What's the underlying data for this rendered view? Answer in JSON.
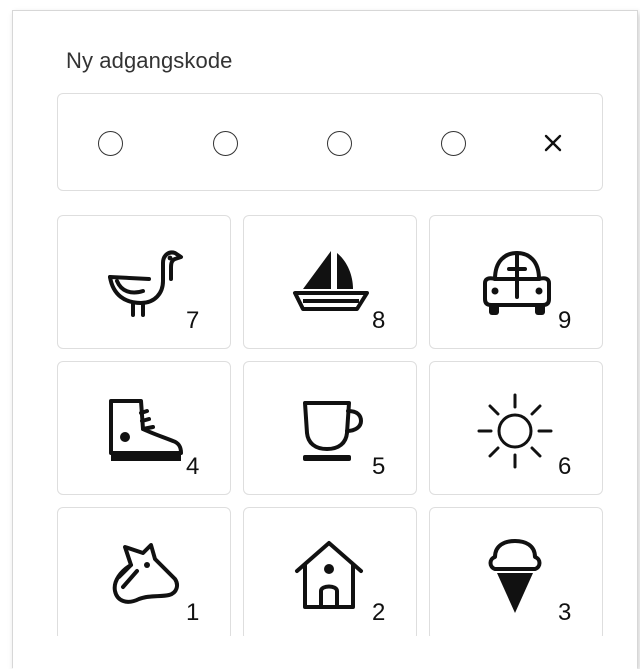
{
  "title": "Ny adgangskode",
  "code": {
    "slots": 4,
    "clear_label": "×"
  },
  "keypad": [
    {
      "icon": "bird-icon",
      "digit": "7"
    },
    {
      "icon": "sailboat-icon",
      "digit": "8"
    },
    {
      "icon": "car-icon",
      "digit": "9"
    },
    {
      "icon": "sneaker-icon",
      "digit": "4"
    },
    {
      "icon": "cup-icon",
      "digit": "5"
    },
    {
      "icon": "sun-icon",
      "digit": "6"
    },
    {
      "icon": "horse-icon",
      "digit": "1"
    },
    {
      "icon": "house-icon",
      "digit": "2"
    },
    {
      "icon": "ice-cream-icon",
      "digit": "3"
    }
  ]
}
